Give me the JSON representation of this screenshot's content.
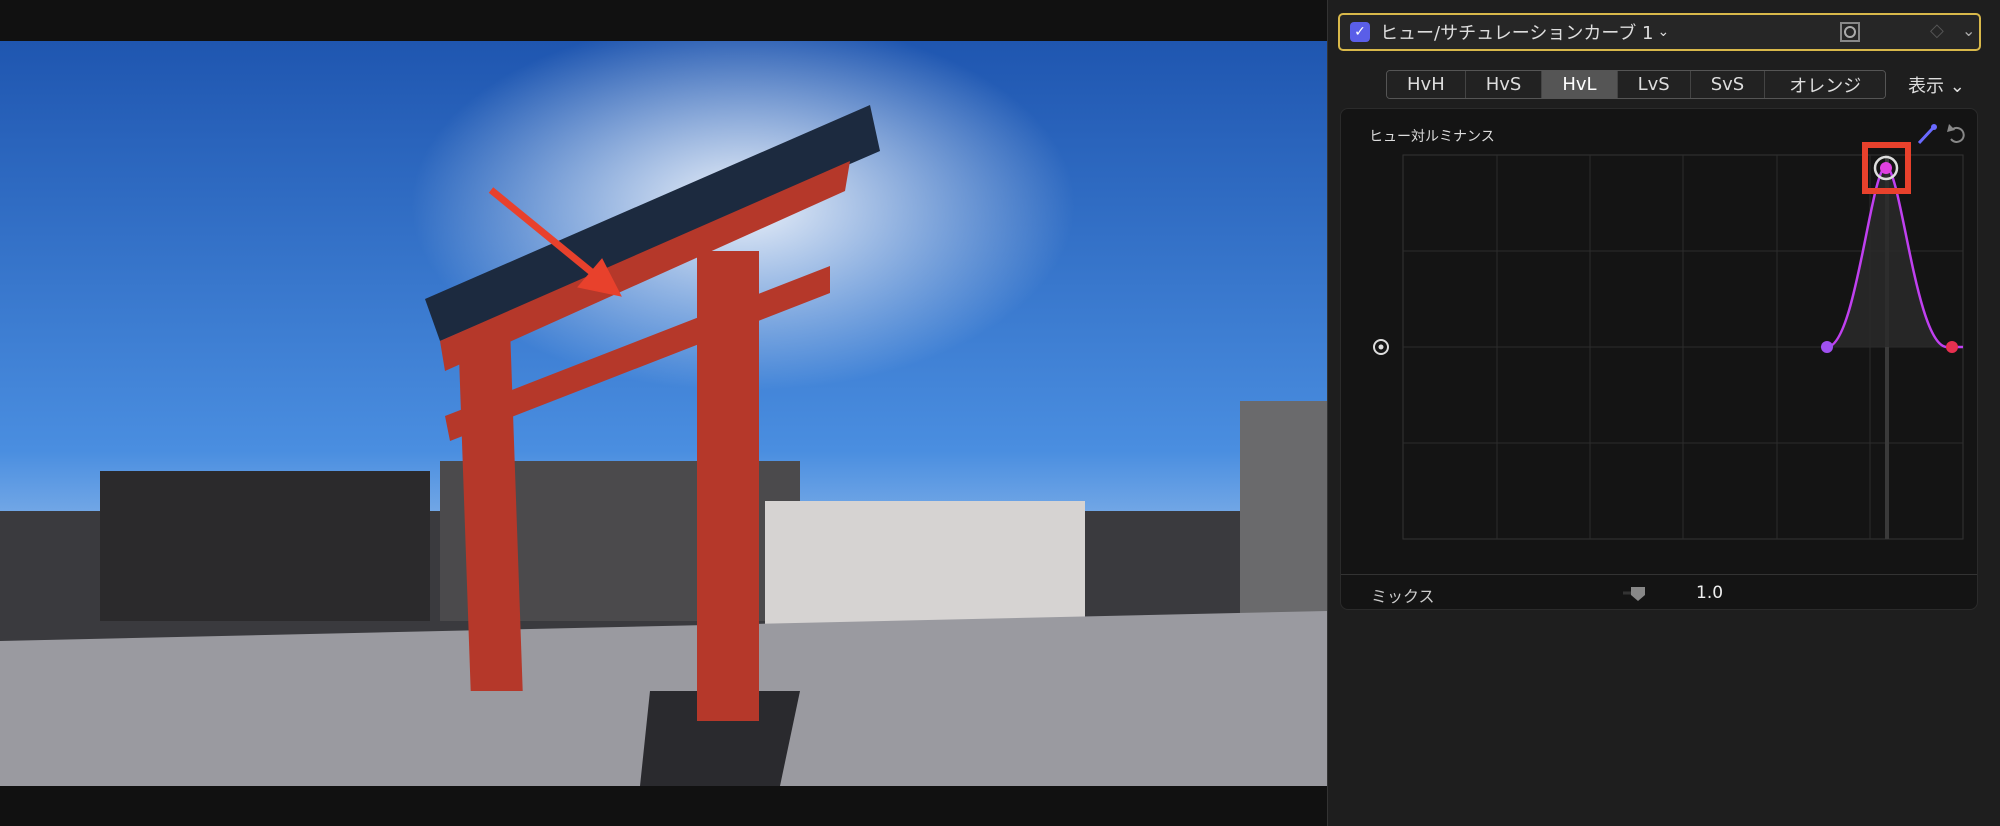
{
  "header": {
    "title": "ヒュー/サチュレーションカーブ 1",
    "enabled": true
  },
  "tabs": [
    {
      "label": "HvH"
    },
    {
      "label": "HvS"
    },
    {
      "label": "HvL",
      "active": true
    },
    {
      "label": "LvS"
    },
    {
      "label": "SvS"
    },
    {
      "label": "オレンジ"
    }
  ],
  "show_menu": "表示",
  "curve": {
    "label": "ヒュー対ルミナンス",
    "highlight_color": "#e8412c"
  },
  "mix": {
    "label": "ミックス",
    "value": "1.0"
  }
}
